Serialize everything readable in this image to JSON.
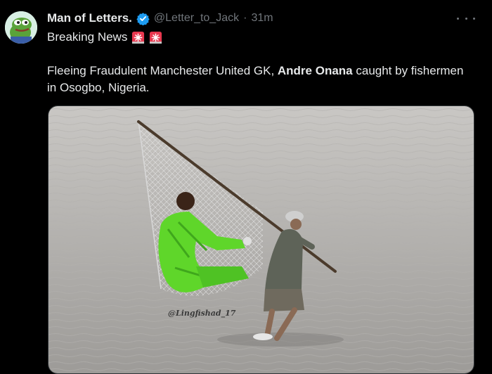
{
  "author": {
    "name": "Man of Letters.",
    "handle": "@Letter_to_Jack",
    "separator": "·",
    "time": "31m",
    "avatar_icon": "pepe-frog-avatar",
    "verified_icon": "verified-badge-icon"
  },
  "tweet": {
    "headline": "Breaking News",
    "emoji_icons": [
      "siren-icon",
      "siren-icon"
    ],
    "text_before": "Fleeing Fraudulent Manchester United GK, ",
    "text_bold": "Andre Onana",
    "text_after": " caught by fishermen in Osogbo, Nigeria."
  },
  "media": {
    "watermark": "@Lingfishad_17"
  },
  "colors": {
    "background": "#000000",
    "text": "#e7e9ea",
    "secondary": "#71767b",
    "verified": "#1d9bf0",
    "kit_green": "#5fd62a"
  }
}
